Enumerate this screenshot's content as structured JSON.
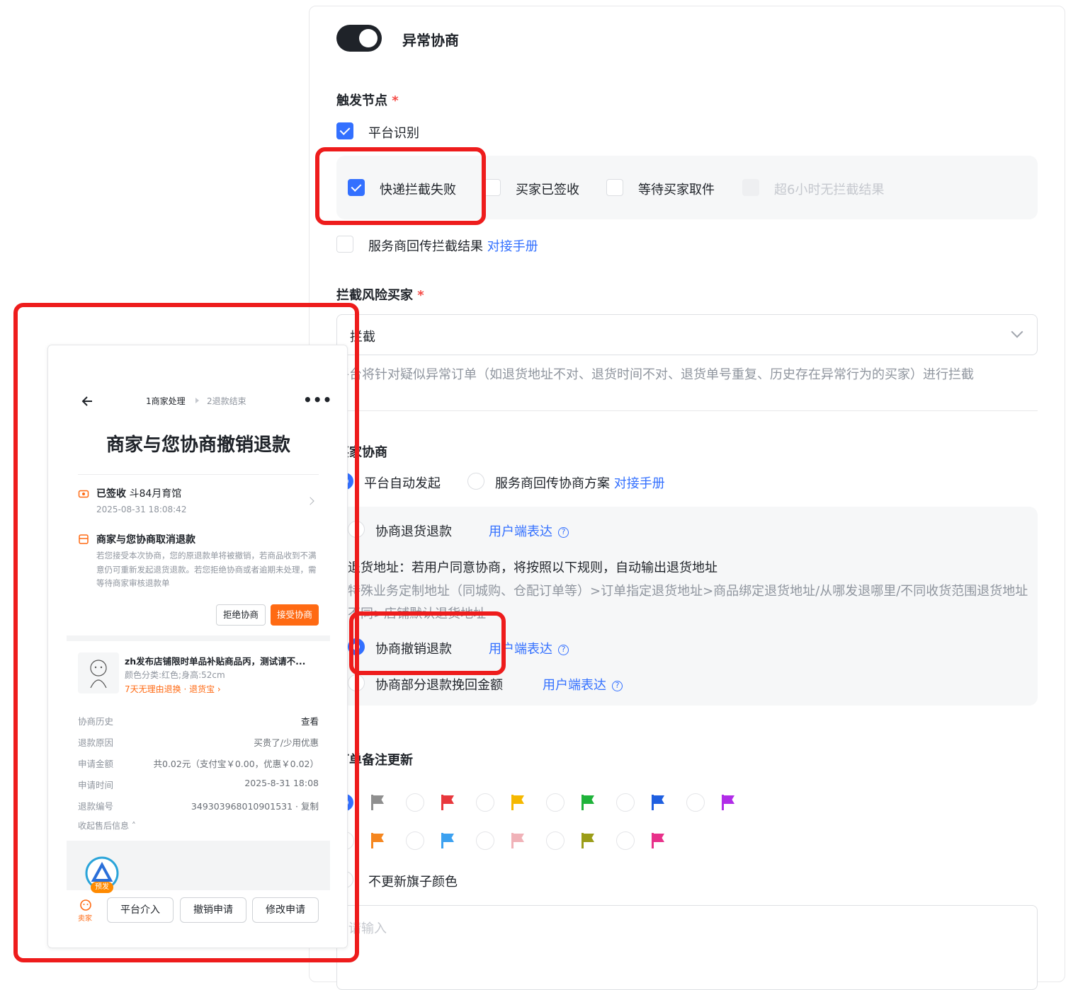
{
  "settings": {
    "title": "异常协商",
    "trigger": {
      "label": "触发节点",
      "platform_label": "平台识别",
      "options": [
        "快递拦截失败",
        "买家已签收",
        "等待买家取件",
        "超6小时无拦截结果"
      ],
      "service_label": "服务商回传拦截结果",
      "service_link": "对接手册"
    },
    "risk": {
      "label": "拦截风险买家",
      "value": "拦截",
      "hint": "平台将针对疑似异常订单（如退货地址不对、退货时间不对、退货单号重复、历史存在异常行为的买家）进行拦截"
    },
    "negotiate": {
      "label": "买家协商",
      "opt_auto": "平台自动发起",
      "opt_service": "服务商回传协商方案",
      "service_link": "对接手册",
      "return_refund": "协商退货退款",
      "express_link": "用户端表达",
      "addr_title": "退货地址：若用户同意协商，将按照以下规则，自动输出退货地址",
      "addr_rule": "特殊业务定制地址（同城购、仓配订单等）>订单指定退货地址>商品绑定退货地址/从哪发退哪里/不同收货范围退货地址不同>店铺默认退货地址",
      "cancel_refund": "协商撤销退款",
      "partial_refund": "协商部分退款挽回金额"
    },
    "remark": {
      "label": "订单备注更新",
      "no_update": "不更新旗子颜色",
      "placeholder": "请输入"
    },
    "flag_colors": {
      "row1": [
        "#8f8f8f",
        "#e8383d",
        "#f5b800",
        "#1fb33a",
        "#1f5fe0",
        "#b12ce8"
      ],
      "row2": [
        "#f5861f",
        "#3ca1f0",
        "#f0b2b8",
        "#9b9d18",
        "#e8318a"
      ]
    }
  },
  "phone": {
    "step1": "1商家处理",
    "step2": "2退款结束",
    "title": "商家与您协商撤销退款",
    "logistics_status": "已签收",
    "logistics_detail": "斗84月育馆",
    "logistics_time": "2025-08-31 18:08:42",
    "notice_title": "商家与您协商取消退款",
    "notice_body": "若您接受本次协商，您的原退款单将被撤销，若商品收到不满意仍可重新发起退货退款。若您拒绝协商或者逾期未处理，需等待商家审核退款单",
    "reject_btn": "拒绝协商",
    "accept_btn": "接受协商",
    "product_name": "zh发布店铺限时单品补贴商品丙，测试请不...",
    "product_spec": "颜色分类:红色;身高:52cm",
    "product_tag": "7天无理由退换 · 退货宝",
    "rows": [
      {
        "k": "协商历史",
        "v": "查看"
      },
      {
        "k": "退款原因",
        "v": "买贵了/少用优惠"
      },
      {
        "k": "申请金额",
        "v": "共0.02元（支付宝￥0.00，优惠￥0.02）"
      },
      {
        "k": "申请时间",
        "v": "2025-8-31 18:08"
      },
      {
        "k": "退款编号",
        "v": "349303968010901531 · 复制"
      }
    ],
    "collapse": "收起售后信息",
    "badge": "预发",
    "seller": "卖家",
    "btn_platform": "平台介入",
    "btn_cancel": "撤销申请",
    "btn_modify": "修改申请"
  }
}
